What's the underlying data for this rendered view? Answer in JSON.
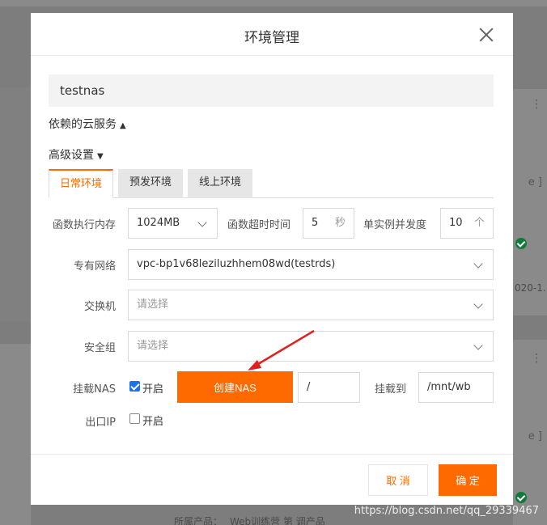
{
  "background": {
    "texts": [
      "e ]",
      "020-1...",
      "e ]",
      "所属产品：",
      "Web训练营  第   调产品"
    ],
    "watermark": "https://blog.csdn.net/qq_29339467"
  },
  "modal": {
    "title": "环境管理",
    "name_value": "testnas",
    "dependent_services_label": "依赖的云服务",
    "advanced_settings_label": "高级设置",
    "expand_up_arrow": "▲",
    "collapse_down_arrow": "▼",
    "tabs": [
      {
        "label": "日常环境",
        "active": true
      },
      {
        "label": "预发环境",
        "active": false
      },
      {
        "label": "线上环境",
        "active": false
      }
    ],
    "memory": {
      "label": "函数执行内存",
      "value": "1024MB"
    },
    "timeout": {
      "label": "函数超时时间",
      "value": "5",
      "unit": "秒"
    },
    "concurrency": {
      "label": "单实例并发度",
      "value": "10",
      "unit": "个"
    },
    "vpc": {
      "label": "专有网络",
      "value": "vpc-bp1v68leziluzhhem08wd(testrds)"
    },
    "vswitch": {
      "label": "交换机",
      "placeholder": "请选择"
    },
    "security_group": {
      "label": "安全组",
      "placeholder": "请选择"
    },
    "nas": {
      "label": "挂载NAS",
      "enable_label": "开启",
      "checked": true,
      "create_button": "创建NAS",
      "path_value": "/",
      "mount_label": "挂载到",
      "mount_value": "/mnt/wb"
    },
    "egress_ip": {
      "label": "出口IP",
      "enable_label": "开启",
      "checked": false
    },
    "cancel_button": "取 消",
    "confirm_button": "确 定"
  },
  "colors": {
    "accent": "#ff6a00",
    "checkbox_blue": "#1a73e8",
    "arrow_red": "#e02020",
    "overlay": "#7d7d7d"
  }
}
